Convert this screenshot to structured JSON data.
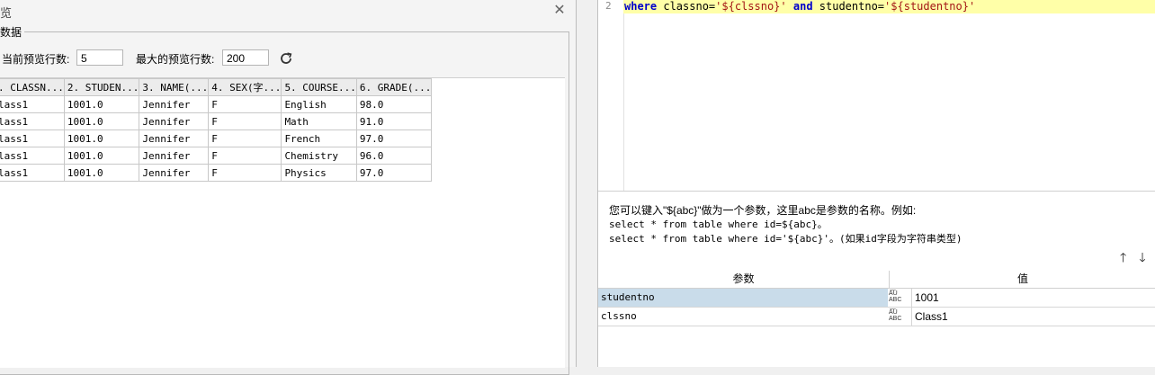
{
  "dialog": {
    "title": "览",
    "close_glyph": "✕",
    "group_label": "数据",
    "current_rows_label": "当前预览行数:",
    "current_rows_value": "5",
    "max_rows_label": "最大的预览行数:",
    "max_rows_value": "200",
    "grid": {
      "columns": [
        ". CLASSN...",
        "2. STUDEN...",
        "3. NAME(...",
        "4. SEX(字...",
        "5. COURSE...",
        "6. GRADE(..."
      ],
      "rows": [
        [
          "lass1",
          "1001.0",
          "Jennifer",
          "F",
          "English",
          "98.0"
        ],
        [
          "lass1",
          "1001.0",
          "Jennifer",
          "F",
          "Math",
          "91.0"
        ],
        [
          "lass1",
          "1001.0",
          "Jennifer",
          "F",
          "French",
          "97.0"
        ],
        [
          "lass1",
          "1001.0",
          "Jennifer",
          "F",
          "Chemistry",
          "96.0"
        ],
        [
          "lass1",
          "1001.0",
          "Jennifer",
          "F",
          "Physics",
          "97.0"
        ]
      ]
    }
  },
  "editor": {
    "line_number": "2",
    "code": {
      "kw1": "where",
      "t1": " classno=",
      "s1": "'${clssno}'",
      "t2": " ",
      "kw2": "and",
      "t3": " studentno=",
      "s2": "'${studentno}'"
    }
  },
  "hint": {
    "line1": "您可以键入\"${abc}\"做为一个参数，这里abc是参数的名称。例如:",
    "line2": "select * from table where id=${abc}。",
    "line3": "select * from table where id='${abc}'。(如果id字段为字符串类型)"
  },
  "params": {
    "header_name": "参数",
    "header_value": "值",
    "up_arrow": "🡑",
    "down_arrow": "🡓",
    "type_icon_text": "A͞U ABC",
    "rows": [
      {
        "name": "studentno",
        "value": "1001"
      },
      {
        "name": "clssno",
        "value": "Class1"
      }
    ]
  },
  "colors": {
    "selected_row": "#c9dcea",
    "code_highlight": "#ffffa8",
    "keyword": "#0000cc",
    "string": "#a31515"
  }
}
